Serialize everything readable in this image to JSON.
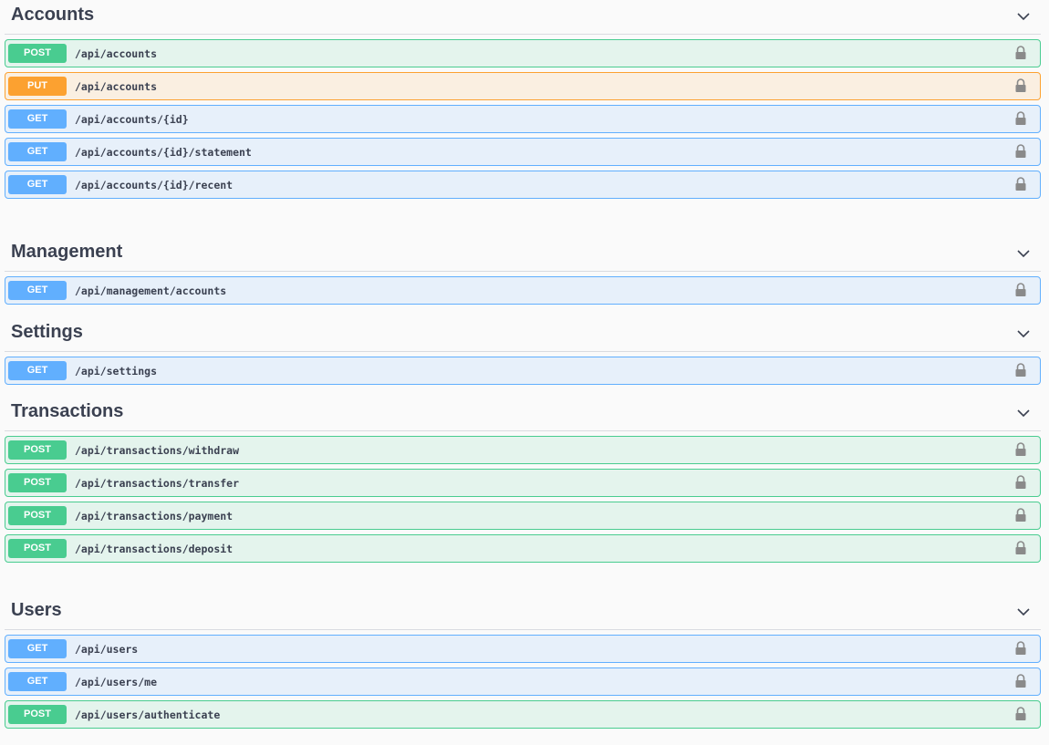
{
  "sections": [
    {
      "title": "Accounts",
      "operations": [
        {
          "method": "POST",
          "path": "/api/accounts"
        },
        {
          "method": "PUT",
          "path": "/api/accounts"
        },
        {
          "method": "GET",
          "path": "/api/accounts/{id}"
        },
        {
          "method": "GET",
          "path": "/api/accounts/{id}/statement"
        },
        {
          "method": "GET",
          "path": "/api/accounts/{id}/recent"
        }
      ]
    },
    {
      "title": "Management",
      "operations": [
        {
          "method": "GET",
          "path": "/api/management/accounts"
        }
      ]
    },
    {
      "title": "Settings",
      "operations": [
        {
          "method": "GET",
          "path": "/api/settings"
        }
      ]
    },
    {
      "title": "Transactions",
      "operations": [
        {
          "method": "POST",
          "path": "/api/transactions/withdraw"
        },
        {
          "method": "POST",
          "path": "/api/transactions/transfer"
        },
        {
          "method": "POST",
          "path": "/api/transactions/payment"
        },
        {
          "method": "POST",
          "path": "/api/transactions/deposit"
        }
      ]
    },
    {
      "title": "Users",
      "operations": [
        {
          "method": "GET",
          "path": "/api/users"
        },
        {
          "method": "GET",
          "path": "/api/users/me"
        },
        {
          "method": "POST",
          "path": "/api/users/authenticate"
        }
      ]
    }
  ],
  "icons": {
    "collapse": "chevron-down-icon",
    "auth": "lock-icon"
  },
  "colors": {
    "post": "#49cc90",
    "put": "#fca130",
    "get": "#61affe",
    "title": "#3b4151"
  }
}
